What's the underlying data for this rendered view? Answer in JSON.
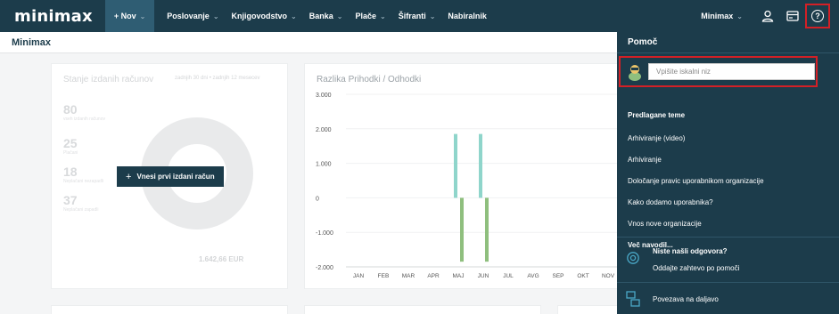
{
  "app": {
    "logo": "minimax",
    "new_label": "+ Nov",
    "nav": [
      "Poslovanje",
      "Knjigovodstvo",
      "Banka",
      "Plače",
      "Šifranti"
    ],
    "nav_inbox": "Nabiralnik",
    "company": "Minimax"
  },
  "page": {
    "title": "Minimax"
  },
  "invoices_card": {
    "title": "Stanje izdanih računov",
    "links": "zadnjih 30 dni • zadnjih 12 mesecev",
    "stats": [
      {
        "value": "80",
        "label": "vseh izdanih računov"
      },
      {
        "value": "25",
        "label": "Plačani"
      },
      {
        "value": "18",
        "label": "Neplačani nezapadli"
      },
      {
        "value": "37",
        "label": "Neplačani zapadli"
      }
    ],
    "total": "1.642,66 EUR",
    "cta_label": "Vnesi prvi izdani račun"
  },
  "chart_data": {
    "type": "bar",
    "title": "Razlika Prihodki / Odhodki",
    "categories": [
      "JAN",
      "FEB",
      "MAR",
      "APR",
      "MAJ",
      "JUN",
      "JUL",
      "AVG",
      "SEP",
      "OKT",
      "NOV"
    ],
    "series": [
      {
        "values": [
          0,
          0,
          0,
          0,
          1850,
          1850,
          0,
          0,
          0,
          0,
          0
        ]
      },
      {
        "values": [
          0,
          0,
          0,
          0,
          -1850,
          -1850,
          0,
          0,
          0,
          0,
          0
        ]
      }
    ],
    "y_ticks": [
      "3.000",
      "2.000",
      "1.000",
      "0",
      "-1.000",
      "-2.000"
    ],
    "ylim": [
      -2000,
      3000
    ],
    "colors": [
      "#8fd5cb",
      "#8fbf7e"
    ]
  },
  "help": {
    "title": "Pomoč",
    "search_placeholder": "Vpišite iskalni niz",
    "suggested_title": "Predlagane teme",
    "topics": [
      "Arhiviranje (video)",
      "Arhiviranje",
      "Določanje pravic uporabnikom organizacije",
      "Kako dodamo uporabnika?",
      "Vnos nove organizacije"
    ],
    "more": "Več navodil...",
    "no_answer": "Niste našli odgovora?",
    "send_request": "Oddajte zahtevo po pomoči",
    "remote": "Povezava na daljavo"
  },
  "colors": {
    "nav": "#1c3c4b",
    "highlight": "#d32026"
  }
}
